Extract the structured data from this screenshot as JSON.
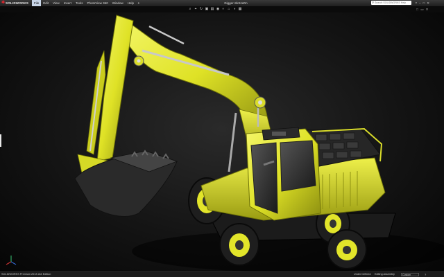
{
  "app": {
    "logo_mark": "✱",
    "logo_text": "SOLIDWORKS",
    "document_title": "Digger-SkSxWm"
  },
  "menu": [
    {
      "label": "File",
      "active": true
    },
    {
      "label": "Edit",
      "active": false
    },
    {
      "label": "View",
      "active": false
    },
    {
      "label": "Insert",
      "active": false
    },
    {
      "label": "Tools",
      "active": false
    },
    {
      "label": "PhotoView 360",
      "active": false
    },
    {
      "label": "Window",
      "active": false
    },
    {
      "label": "Help",
      "active": false
    }
  ],
  "menu_pin": "✦",
  "search": {
    "placeholder": "Search SOLIDWORKS Help"
  },
  "window_buttons": [
    "?",
    "–",
    "□",
    "✕"
  ],
  "headsup_toolbar": [
    "⌕",
    "⌖",
    "↻",
    "▣",
    "▤",
    "◉",
    "◐",
    "⌂",
    "◑",
    "▦"
  ],
  "viewport_controls": [
    "□",
    "▭",
    "✕"
  ],
  "status": {
    "product": "SOLIDWORKS Premium 2013 x64 Edition",
    "fields": [
      "Under Defined",
      "Editing Assembly"
    ],
    "units": "Custom",
    "help": "?"
  },
  "colors": {
    "machine_yellow": "#e3e62a",
    "machine_dark": "#8a8d10",
    "tire": "#1e1e1e",
    "menu_active": "#c9d6e8",
    "logo_red": "#d8262e"
  },
  "icons": {
    "search": "search-icon",
    "triad": "view-orientation-triad-icon"
  }
}
